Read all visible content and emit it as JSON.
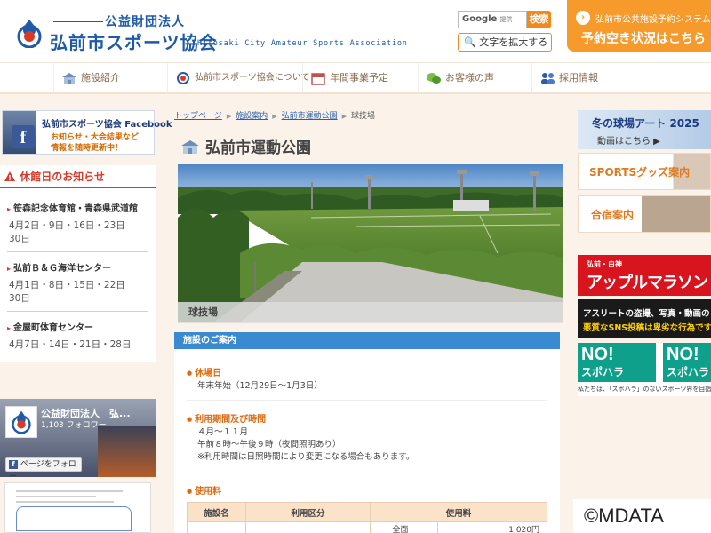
{
  "header": {
    "org_prefix": "公益財団法人",
    "org_name": "弘前市スポーツ協会",
    "org_name_en": "Hirosaki City Amateur Sports Association",
    "search_placeholder": "Google",
    "search_provider_note": "提供",
    "search_button": "検索",
    "enlarge_text_button": "文字を拡大する",
    "reservation": {
      "line1": "弘前市公共施設予約システム",
      "line2": "予約空き状況はこちら"
    }
  },
  "nav": [
    {
      "label": "施設紹介",
      "icon": "building-icon"
    },
    {
      "label": "弘前市スポーツ協会について",
      "icon": "logo-icon"
    },
    {
      "label": "年間事業予定",
      "icon": "calendar-icon"
    },
    {
      "label": "お客様の声",
      "icon": "chat-icon"
    },
    {
      "label": "採用情報",
      "icon": "people-icon"
    }
  ],
  "sidebar_left": {
    "fb_banner": {
      "title": "弘前市スポーツ協会 Facebook",
      "line1": "お知らせ・大会結果など",
      "line2": "情報を随時更新中！"
    },
    "closed_days": {
      "title": "休館日のお知らせ",
      "facilities": [
        {
          "name": "笹森記念体育館・青森県武道館",
          "dates": [
            "4月2日・9日・16日・23日",
            "30日"
          ]
        },
        {
          "name": "弘前Ｂ＆Ｇ海洋センター",
          "dates": [
            "4月1日・8日・15日・22日",
            "30日"
          ]
        },
        {
          "name": "金屋町体育センター",
          "dates": [
            "4月7日・14日・21日・28日"
          ]
        }
      ]
    },
    "fb_widget": {
      "name": "公益財団法人　弘...",
      "followers": "1,103 フォロワー",
      "follow_button": "ページをフォロー"
    }
  },
  "breadcrumb": [
    "トップページ",
    "施設案内",
    "弘前市運動公園",
    "球技場"
  ],
  "page_title": "弘前市運動公園",
  "hero_caption": "球技場",
  "info": {
    "heading": "施設のご案内",
    "closed_title": "休場日",
    "closed_body": "年末年始（12月29日〜1月3日）",
    "hours_title": "利用期間及び時間",
    "hours_lines": [
      "４月〜１１月",
      "午前８時〜午後９時（夜間照明あり）",
      "※利用時間は日照時間により変更になる場合もあります。"
    ],
    "fee_title": "使用料",
    "fee_headers": [
      "施設名",
      "利用区分",
      "使用料"
    ],
    "fee_row": [
      "",
      "",
      "全面",
      "1,020円"
    ]
  },
  "sidebar_right": {
    "winter": {
      "line1": "冬の球場アート 2025",
      "line2": "動画はこちら ▶"
    },
    "goods": "SPORTSグッズ案内",
    "camp": "合宿案内",
    "marathon": {
      "sub": "弘前・白神",
      "title": "アップルマラソン"
    },
    "athlete": {
      "line1": "アスリートの盗撮、写真・動画の",
      "line2": "悪質なSNS投稿は卑劣な行為です"
    },
    "nospo": {
      "no": "NO!",
      "label": "スポハラ",
      "footer": "私たちは、「スポハラ」のないスポーツ界を目指します。"
    }
  },
  "watermark": "©MDATA"
}
